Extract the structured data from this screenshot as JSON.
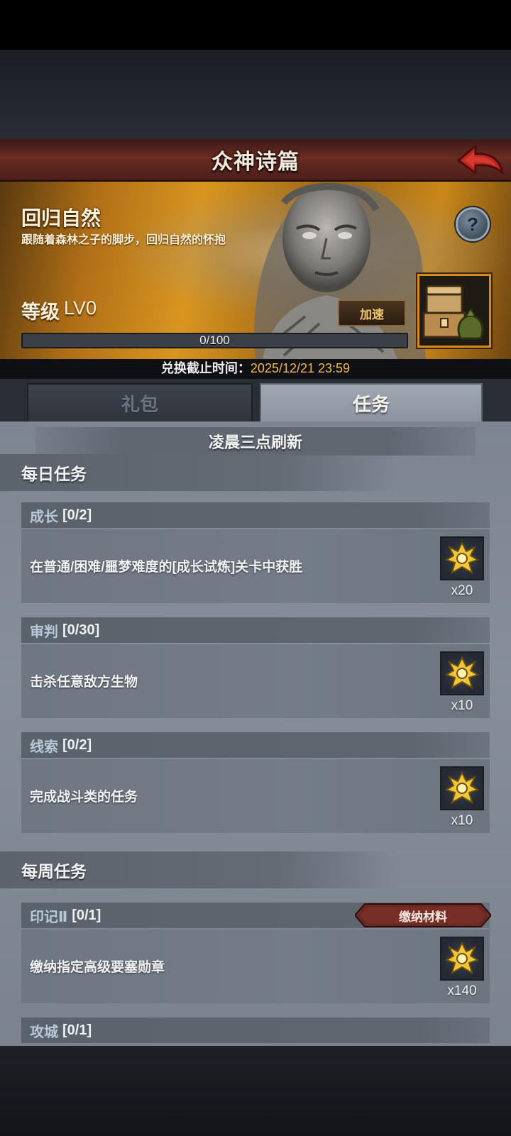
{
  "header": {
    "title": "众神诗篇"
  },
  "banner": {
    "title": "回归自然",
    "subtitle": "跟随着森林之子的脚步，回归自然的怀抱",
    "level_label": "等级",
    "level_value": "LV0",
    "speed_button": "加速",
    "progress": {
      "text": "0/100",
      "value": 0,
      "max": 100
    },
    "deadline_label": "兑换截止时间：",
    "deadline_time": "2025/12/21 23:59"
  },
  "tabs": [
    {
      "label": "礼包",
      "active": false
    },
    {
      "label": "任务",
      "active": true
    }
  ],
  "refresh_note": "凌晨三点刷新",
  "daily": {
    "title": "每日任务",
    "tasks": [
      {
        "category": "成长",
        "count": "[0/2]",
        "desc": "在普通/困难/噩梦难度的[成长试炼]关卡中获胜",
        "reward": "x20"
      },
      {
        "category": "审判",
        "count": "[0/30]",
        "desc": "击杀任意敌方生物",
        "reward": "x10"
      },
      {
        "category": "线索",
        "count": "[0/2]",
        "desc": "完成战斗类的任务",
        "reward": "x10"
      }
    ]
  },
  "weekly": {
    "title": "每周任务",
    "tasks": [
      {
        "category": "印记Ⅱ",
        "count": "[0/1]",
        "desc": "缴纳指定高级要塞勋章",
        "reward": "x140",
        "action": "缴纳材料"
      },
      {
        "category": "攻城",
        "count": "[0/1]"
      }
    ]
  },
  "colors": {
    "header_red": "#6b2c23",
    "banner_gold": "#d8951f",
    "deadline_time": "#f2b84a",
    "task_category": "#b8c8d8",
    "panel_gray": "#7c8590"
  },
  "icons": {
    "back": "red-back-arrow-icon",
    "help": "question-mark-icon",
    "chest": "treasure-chest-icon",
    "reward": "gold-emblem-icon"
  }
}
